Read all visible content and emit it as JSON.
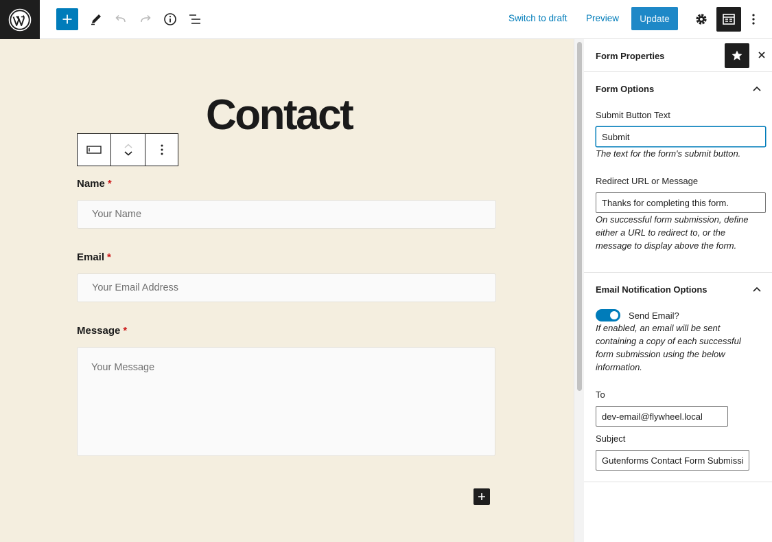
{
  "toolbar": {
    "switch_to_draft": "Switch to draft",
    "preview": "Preview",
    "update": "Update"
  },
  "page": {
    "title": "Contact"
  },
  "form": {
    "name_label": "Name",
    "name_placeholder": "Your Name",
    "email_label": "Email",
    "email_placeholder": "Your Email Address",
    "message_label": "Message",
    "message_placeholder": "Your Message",
    "required_mark": "*"
  },
  "sidebar": {
    "title": "Form Properties",
    "form_options": {
      "title": "Form Options",
      "submit_label": "Submit Button Text",
      "submit_value": "Submit",
      "submit_help": "The text for the form's submit button.",
      "redirect_label": "Redirect URL or Message",
      "redirect_value": "Thanks for completing this form.",
      "redirect_help": "On successful form submission, define either a URL to redirect to, or the message to display above the form."
    },
    "email_options": {
      "title": "Email Notification Options",
      "send_email_label": "Send Email?",
      "send_email_enabled": true,
      "send_email_help": "If enabled, an email will be sent containing a copy of each successful form submission using the below information.",
      "to_label": "To",
      "to_value": "dev-email@flywheel.local",
      "subject_label": "Subject",
      "subject_value": "Gutenforms Contact Form Submission"
    }
  },
  "colors": {
    "accent": "#007cba",
    "canvas_bg": "#f4eedf",
    "dark": "#1e1e1e",
    "required": "#cc1818"
  }
}
